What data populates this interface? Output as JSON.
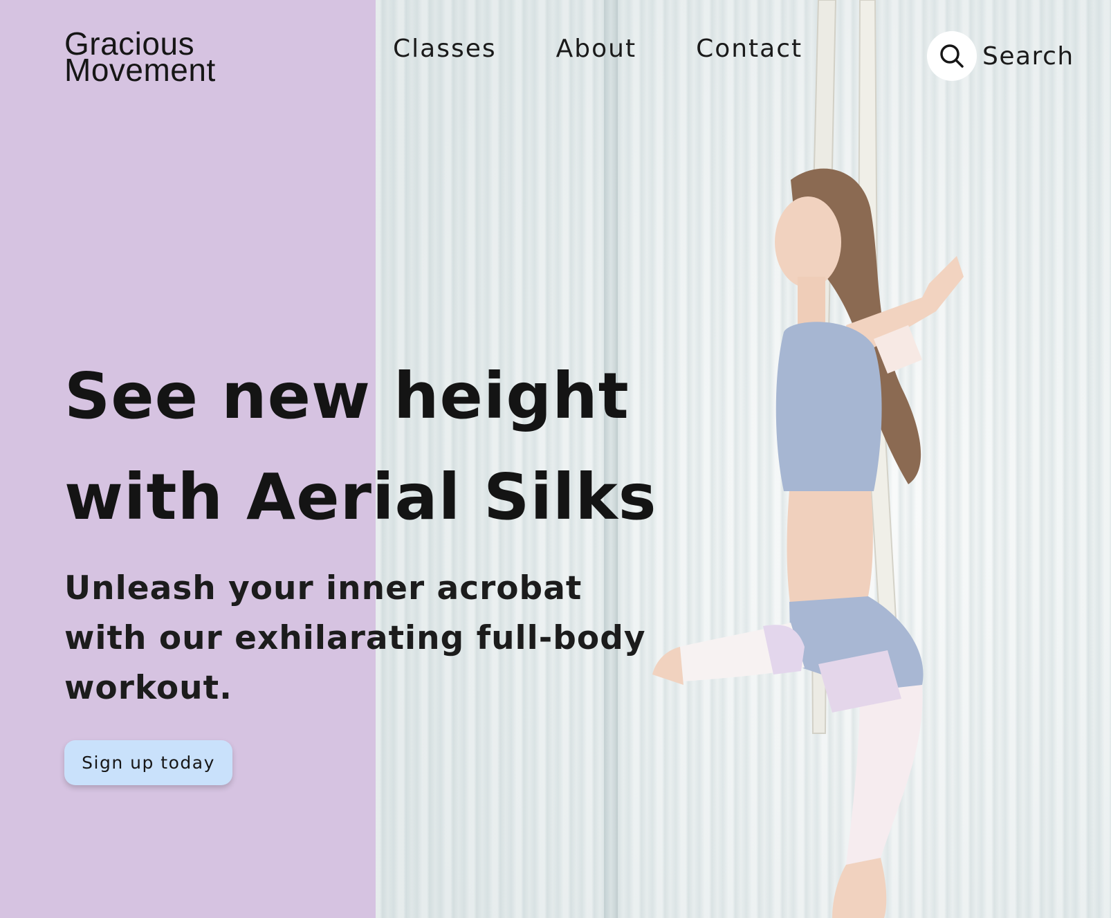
{
  "brand": {
    "line1": "Gracious",
    "line2": "Movement"
  },
  "nav": {
    "items": [
      {
        "label": "Classes"
      },
      {
        "label": "About"
      },
      {
        "label": "Contact"
      }
    ],
    "search_label": "Search",
    "search_icon": "search-icon"
  },
  "hero": {
    "headline_line1": "See new height",
    "headline_line2": "with Aerial Silks",
    "subhead": "Unleash your inner acrobat with our exhilarating full-body workout.",
    "cta_label": "Sign up today"
  },
  "colors": {
    "panel": "#d6c3e1",
    "cta": "#c9e1fb",
    "text": "#141414"
  }
}
